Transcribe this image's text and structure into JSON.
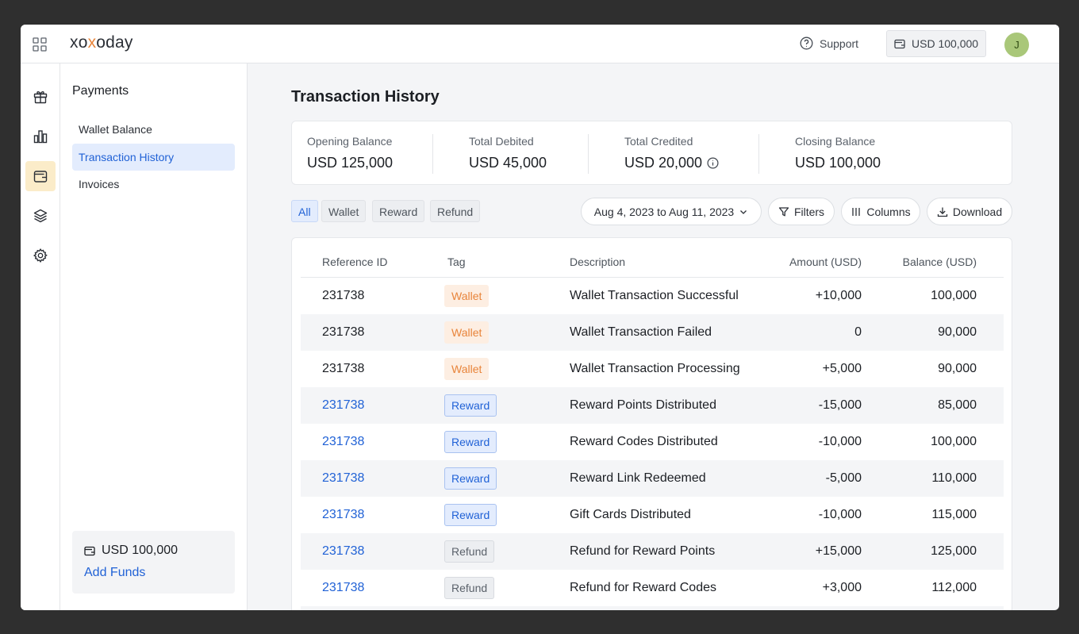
{
  "header": {
    "logo": {
      "a": "xo",
      "b": "x",
      "c": "oday"
    },
    "support_label": "Support",
    "balance": "USD 100,000",
    "avatar_initial": "J"
  },
  "rail": {
    "items": [
      {
        "icon": "gift-icon",
        "active": false
      },
      {
        "icon": "chart-icon",
        "active": false
      },
      {
        "icon": "wallet-icon",
        "active": true
      },
      {
        "icon": "layers-icon",
        "active": false
      },
      {
        "icon": "gear-icon",
        "active": false
      }
    ]
  },
  "subnav": {
    "title": "Payments",
    "items": [
      {
        "label": "Wallet Balance",
        "active": false
      },
      {
        "label": "Transaction History",
        "active": true
      },
      {
        "label": "Invoices",
        "active": false
      }
    ],
    "funds": {
      "amount": "USD 100,000",
      "link": "Add Funds"
    }
  },
  "page": {
    "title": "Transaction History"
  },
  "summary": [
    {
      "label": "Opening Balance",
      "value": "USD 125,000"
    },
    {
      "label": "Total Debited",
      "value": "USD 45,000"
    },
    {
      "label": "Total Credited",
      "value": "USD 20,000"
    },
    {
      "label": "Closing Balance",
      "value": "USD 100,000"
    }
  ],
  "filters": {
    "tags": [
      "All",
      "Wallet",
      "Reward",
      "Refund"
    ],
    "active_tag": "All",
    "date_range": "Aug 4, 2023 to Aug 11, 2023",
    "filters_label": "Filters",
    "columns_label": "Columns",
    "download_label": "Download"
  },
  "table": {
    "headers": [
      "Reference ID",
      "Tag",
      "Description",
      "Amount (USD)",
      "Balance (USD)"
    ],
    "rows": [
      {
        "ref": "231738",
        "tag": "Wallet",
        "desc": "Wallet Transaction Successful",
        "amount": "+10,000",
        "balance": "100,000"
      },
      {
        "ref": "231738",
        "tag": "Wallet",
        "desc": "Wallet Transaction Failed",
        "amount": "0",
        "balance": "90,000"
      },
      {
        "ref": "231738",
        "tag": "Wallet",
        "desc": "Wallet Transaction Processing",
        "amount": "+5,000",
        "balance": "90,000"
      },
      {
        "ref": "231738",
        "tag": "Reward",
        "desc": "Reward Points Distributed",
        "amount": "-15,000",
        "balance": "85,000"
      },
      {
        "ref": "231738",
        "tag": "Reward",
        "desc": "Reward Codes Distributed",
        "amount": "-10,000",
        "balance": "100,000"
      },
      {
        "ref": "231738",
        "tag": "Reward",
        "desc": "Reward Link Redeemed",
        "amount": "-5,000",
        "balance": "110,000"
      },
      {
        "ref": "231738",
        "tag": "Reward",
        "desc": "Gift Cards Distributed",
        "amount": "-10,000",
        "balance": "115,000"
      },
      {
        "ref": "231738",
        "tag": "Refund",
        "desc": "Refund for Reward Points",
        "amount": "+15,000",
        "balance": "125,000"
      },
      {
        "ref": "231738",
        "tag": "Refund",
        "desc": "Refund for Reward Codes",
        "amount": "+3,000",
        "balance": "112,000"
      }
    ]
  },
  "colors": {
    "accent": "#2162d6",
    "wallet_tag": "#e8843a",
    "rail_active": "#fbecc9"
  }
}
